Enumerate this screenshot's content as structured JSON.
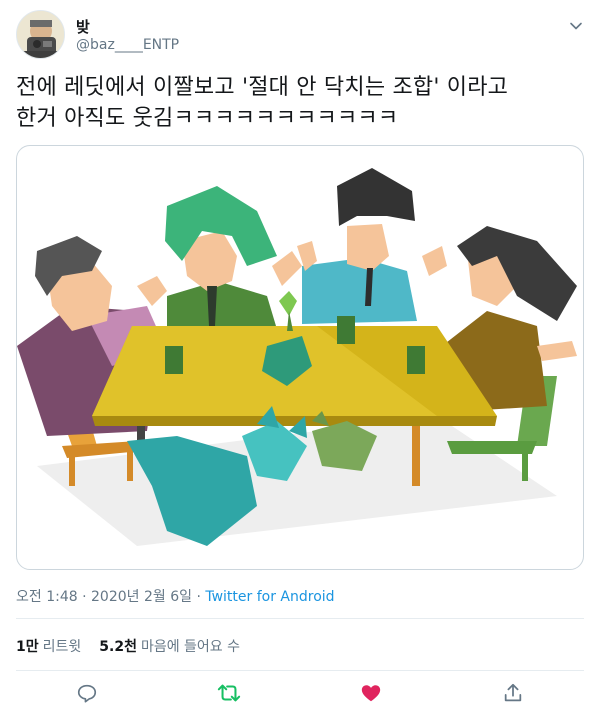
{
  "tweet": {
    "display_name": "밪",
    "handle": "@baz____ENTP",
    "text_line1": "전에 레딧에서 이짤보고 '절대 안 닥치는 조합' 이라고",
    "text_line2": "한거 아직도 웃김ㅋㅋㅋㅋㅋㅋㅋㅋㅋㅋㅋ",
    "time": "오전 1:48",
    "date": "2020년 2월 6일",
    "separator": "·",
    "source": "Twitter for Android",
    "retweets_count": "1만",
    "retweets_label": "리트윗",
    "likes_count": "5.2천",
    "likes_label": "마음에 들어요 수"
  },
  "icons": {
    "reply": "reply-icon",
    "retweet": "retweet-icon",
    "like": "heart-icon",
    "share": "share-icon",
    "menu": "chevron-down-icon"
  },
  "colors": {
    "text": "#14171a",
    "secondary": "#657786",
    "link": "#1b95e0",
    "retweet_active": "#17bf63",
    "like_active": "#e0245e",
    "border": "#e6ecf0"
  }
}
